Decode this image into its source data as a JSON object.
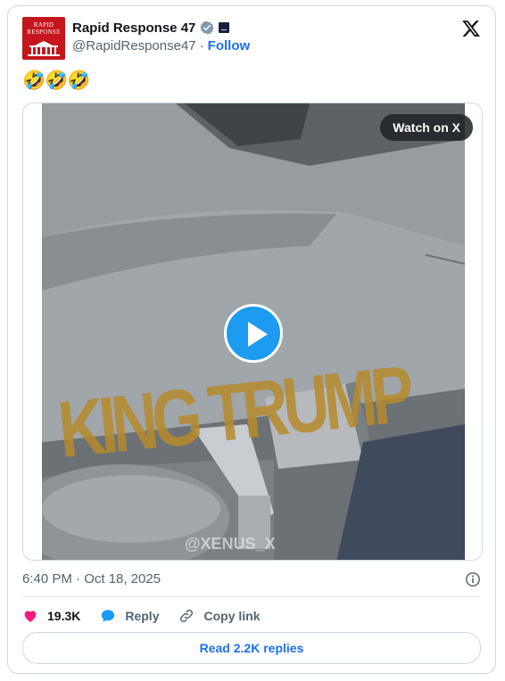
{
  "author": {
    "avatar_text": "RAPID RESPONSE",
    "name": "Rapid Response 47",
    "handle": "@RapidResponse47",
    "separator": "·",
    "follow_label": "Follow"
  },
  "post": {
    "text": "🤣🤣🤣",
    "timestamp": "6:40 PM · Oct 18, 2025"
  },
  "media": {
    "watch_label": "Watch on X",
    "video_text_main": "KING TRUMP",
    "watermark": "@XENUS_X"
  },
  "actions": {
    "likes_count": "19.3K",
    "reply_label": "Reply",
    "copy_link_label": "Copy link",
    "read_replies_label": "Read 2.2K replies"
  },
  "colors": {
    "accent": "#1d9bf0",
    "link": "#1d6ff2",
    "like": "#f91880",
    "avatar_bg": "#c4161c"
  }
}
